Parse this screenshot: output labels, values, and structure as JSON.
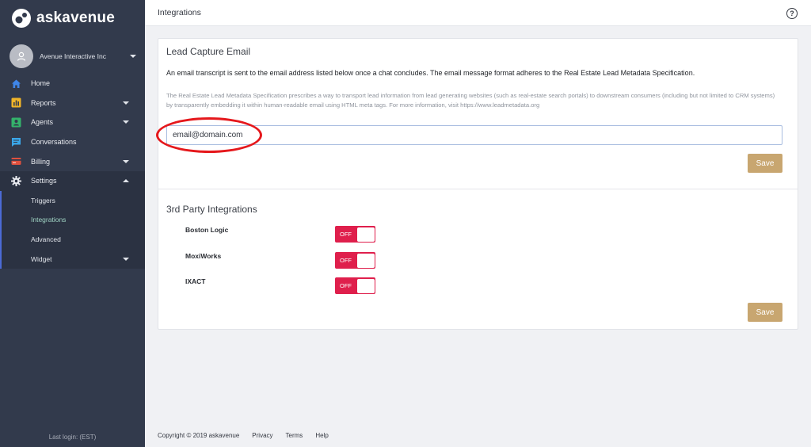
{
  "brand": {
    "name": "askavenue",
    "accent": "#c8a670"
  },
  "account": {
    "name": "Avenue Interactive Inc"
  },
  "nav": {
    "home": "Home",
    "reports": "Reports",
    "agents": "Agents",
    "conversations": "Conversations",
    "billing": "Billing",
    "settings": "Settings",
    "sub": {
      "triggers": "Triggers",
      "integrations": "Integrations",
      "advanced": "Advanced",
      "widget": "Widget"
    }
  },
  "last_login": "Last login: (EST)",
  "page": {
    "title": "Integrations",
    "help_icon": "help-circle-icon"
  },
  "lead_capture": {
    "title": "Lead Capture Email",
    "description": "An email transcript is sent to the email address listed below once a chat concludes. The email message format adheres to the Real Estate Lead Metadata Specification.",
    "spec_text": "The Real Estate Lead Metadata Specification prescribes a way to transport lead information from lead generating websites (such as real-estate search portals) to downstream consumers (including but not limited to CRM systems) by transparently embedding it within human-readable email using HTML meta tags. For more information, visit https://www.leadmetadata.org",
    "email_value": "email@domain.com",
    "save_label": "Save"
  },
  "third_party": {
    "title": "3rd Party Integrations",
    "items": [
      {
        "name": "Boston Logic",
        "state": "OFF"
      },
      {
        "name": "MoxiWorks",
        "state": "OFF"
      },
      {
        "name": "IXACT",
        "state": "OFF"
      }
    ],
    "save_label": "Save"
  },
  "footer": {
    "copyright": "Copyright © 2019 askavenue",
    "privacy": "Privacy",
    "terms": "Terms",
    "help": "Help"
  },
  "colors": {
    "sidebar": "#323a4c",
    "toggle_off": "#df1f4c",
    "active_sub": "#9fd3c3",
    "annotation": "#e5181c"
  }
}
